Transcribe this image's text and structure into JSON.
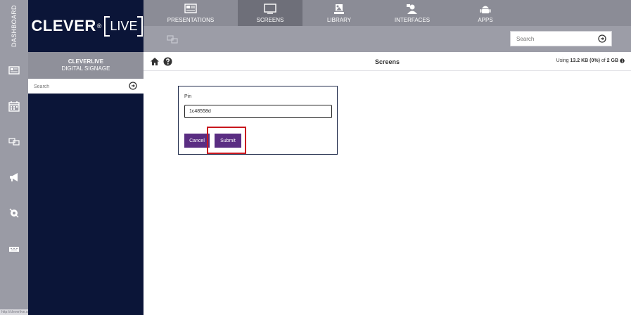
{
  "rail": {
    "label": "DASHBOARD",
    "icons": [
      "presentation-icon",
      "calendar-icon",
      "screens-icon",
      "megaphone-icon",
      "interfaces-icon",
      "keyboard-icon"
    ],
    "footer": "http://cleverlive.com"
  },
  "logo": {
    "brand": "CLEVER",
    "reg": "®",
    "suffix": "LIVE"
  },
  "nav": {
    "tabs": [
      {
        "label": "PRESENTATIONS",
        "icon": "presentation-icon"
      },
      {
        "label": "SCREENS",
        "icon": "monitor-icon",
        "active": true
      },
      {
        "label": "LIBRARY",
        "icon": "library-icon"
      },
      {
        "label": "INTERFACES",
        "icon": "interfaces-icon"
      },
      {
        "label": "APPS",
        "icon": "android-icon"
      }
    ]
  },
  "subbar": {
    "icon": "screens-icon",
    "search_placeholder": "Search"
  },
  "sidebar": {
    "title_line1": "CLEVERLIVE",
    "title_line2": "DIGITAL SIGNAGE",
    "search_placeholder": "Search"
  },
  "header": {
    "title": "Screens",
    "usage_prefix": "Using",
    "usage_value": "13.2 KB (0%)",
    "usage_mid": "of",
    "usage_total": "2 GB"
  },
  "dialog": {
    "pin_label": "Pin",
    "pin_value": "1c48558d",
    "cancel_label": "Cancel",
    "submit_label": "Submit"
  },
  "colors": {
    "navy": "#0b1538",
    "purple": "#5a2d82",
    "highlight": "#c8161d",
    "nav_bg": "#8b8c96",
    "nav_active": "#6e6f79"
  }
}
